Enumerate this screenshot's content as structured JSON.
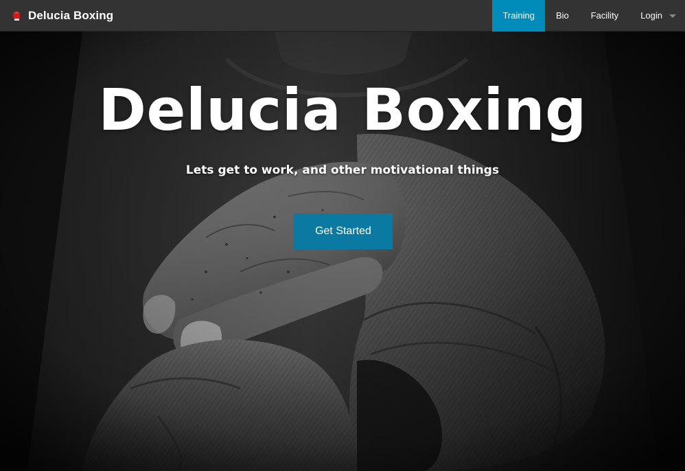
{
  "navbar": {
    "brand": {
      "icon": "boxing-glove-icon",
      "name": "Delucia Boxing",
      "icon_color": "#cc1b1b"
    },
    "items": [
      {
        "label": "Training",
        "active": true
      },
      {
        "label": "Bio",
        "active": false
      },
      {
        "label": "Facility",
        "active": false
      },
      {
        "label": "Login",
        "active": false,
        "dropdown": true
      }
    ],
    "background_color": "#333333",
    "active_color": "#008cba"
  },
  "hero": {
    "title": "Delucia Boxing",
    "subtitle": "Lets get to work, and other motivational things",
    "cta_label": "Get Started",
    "cta_color": "#0a7aa3",
    "background_image": "black-and-white-wrapped-boxing-hands"
  }
}
